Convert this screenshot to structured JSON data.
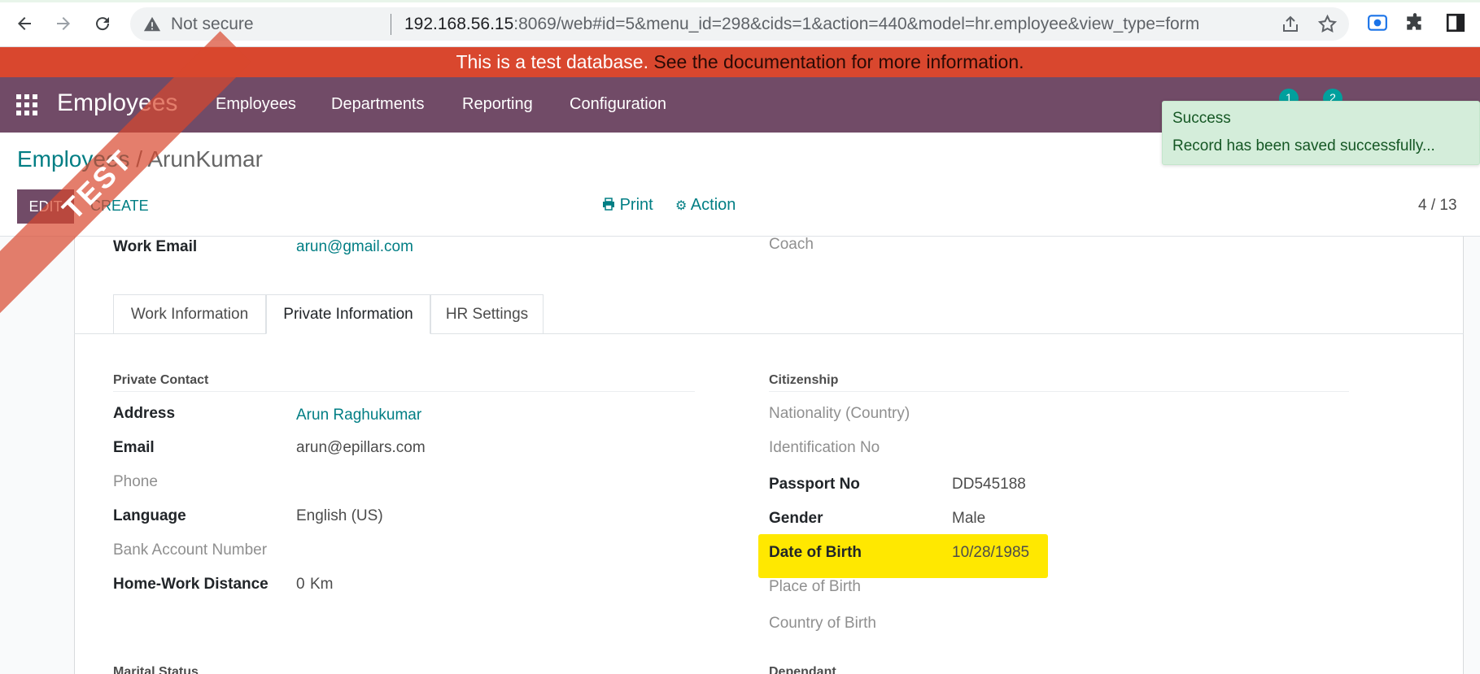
{
  "browser": {
    "security_label": "Not secure",
    "url_host": "192.168.56.15",
    "url_rest": ":8069/web#id=5&menu_id=298&cids=1&action=440&model=hr.employee&view_type=form"
  },
  "banner": {
    "text": "This is a test database.",
    "link": "See the documentation for more information."
  },
  "navbar": {
    "app_title": "Employees",
    "menu": [
      "Employees",
      "Departments",
      "Reporting",
      "Configuration"
    ],
    "badges": [
      "1",
      "2"
    ]
  },
  "breadcrumb": {
    "parent": "Employees",
    "separator": " / ",
    "current": "ArunKumar"
  },
  "control_panel": {
    "edit_label": "EDIT",
    "create_label": "CREATE",
    "print_label": "Print",
    "action_label": "Action",
    "pager": "4 / 13"
  },
  "ribbon": {
    "text": "TEST"
  },
  "toast": {
    "title": "Success",
    "message": "Record has been saved successfully..."
  },
  "form": {
    "work_email_label": "Work Email",
    "work_email_value": "arun@gmail.com",
    "coach_label": "Coach",
    "tabs": [
      "Work Information",
      "Private Information",
      "HR Settings"
    ],
    "active_tab": "Private Information",
    "private_contact": {
      "title": "Private Contact",
      "address_label": "Address",
      "address_value": "Arun Raghukumar",
      "email_label": "Email",
      "email_value": "arun@epillars.com",
      "phone_label": "Phone",
      "language_label": "Language",
      "language_value": "English (US)",
      "bank_label": "Bank Account Number",
      "distance_label": "Home-Work Distance",
      "distance_value": "0",
      "distance_unit": "Km"
    },
    "citizenship": {
      "title": "Citizenship",
      "nationality_label": "Nationality (Country)",
      "identification_label": "Identification No",
      "passport_label": "Passport No",
      "passport_value": "DD545188",
      "gender_label": "Gender",
      "gender_value": "Male",
      "dob_label": "Date of Birth",
      "dob_value": "10/28/1985",
      "pob_label": "Place of Birth",
      "cob_label": "Country of Birth"
    },
    "marital_title": "Marital Status",
    "dependant_title": "Dependant"
  },
  "colors": {
    "brand": "#714b67",
    "banner": "#d9472e",
    "link": "#017e84",
    "highlight": "#ffe800",
    "toast_bg": "#d4edda"
  }
}
